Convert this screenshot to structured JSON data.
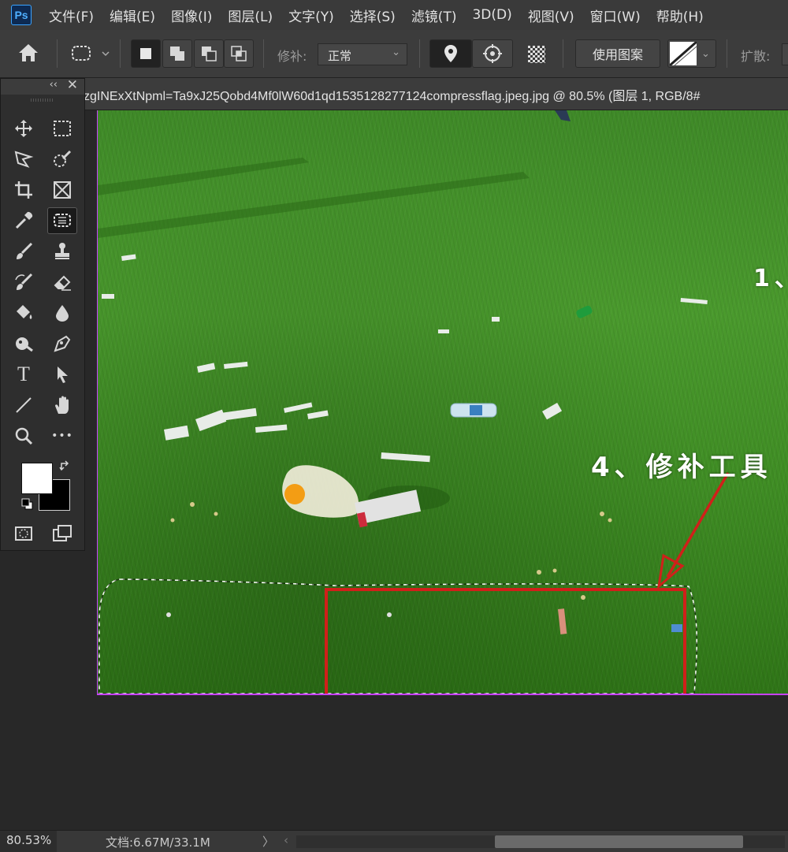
{
  "app": {
    "logo": "Ps"
  },
  "menu": [
    "文件(F)",
    "编辑(E)",
    "图像(I)",
    "图层(L)",
    "文字(Y)",
    "选择(S)",
    "滤镜(T)",
    "3D(D)",
    "视图(V)",
    "窗口(W)",
    "帮助(H)"
  ],
  "options": {
    "patch_label": "修补:",
    "patch_mode": "正常",
    "use_pattern": "使用图案",
    "diffuse_label": "扩散:"
  },
  "document": {
    "tab_title": "zgINExXtNpml=Ta9xJ25Qobd4Mf0lW60d1qd1535128277124compressflag.jpeg.jpg  @  80.5%  (图层 1, RGB/8#"
  },
  "tools": {
    "collapse": "‹‹",
    "close": "✕",
    "items": [
      "move-tool",
      "marquee-tool",
      "polygon-lasso-tool",
      "quick-selection-tool",
      "crop-tool",
      "frame-tool",
      "eyedropper-tool",
      "patch-tool",
      "brush-tool",
      "clone-stamp-tool",
      "history-brush-tool",
      "eraser-tool",
      "paint-bucket-tool",
      "blur-tool",
      "dodge-tool",
      "pen-tool",
      "type-tool",
      "path-selection-tool",
      "line-tool",
      "hand-tool",
      "zoom-tool",
      "more-tools"
    ],
    "active": "patch-tool",
    "type_glyph": "T",
    "more_glyph": "•••",
    "foreground_color": "#ffffff",
    "background_color": "#000000"
  },
  "canvas": {
    "annotation_top": "1、",
    "annotation_main": "4、修补工具"
  },
  "status": {
    "zoom": "80.53%",
    "doc_size": "文档:6.67M/33.1M",
    "arrow": "〉",
    "scroll_left": "‹"
  },
  "colors": {
    "accent_selection": "#c742ff",
    "annotation_red": "#d0201a"
  }
}
